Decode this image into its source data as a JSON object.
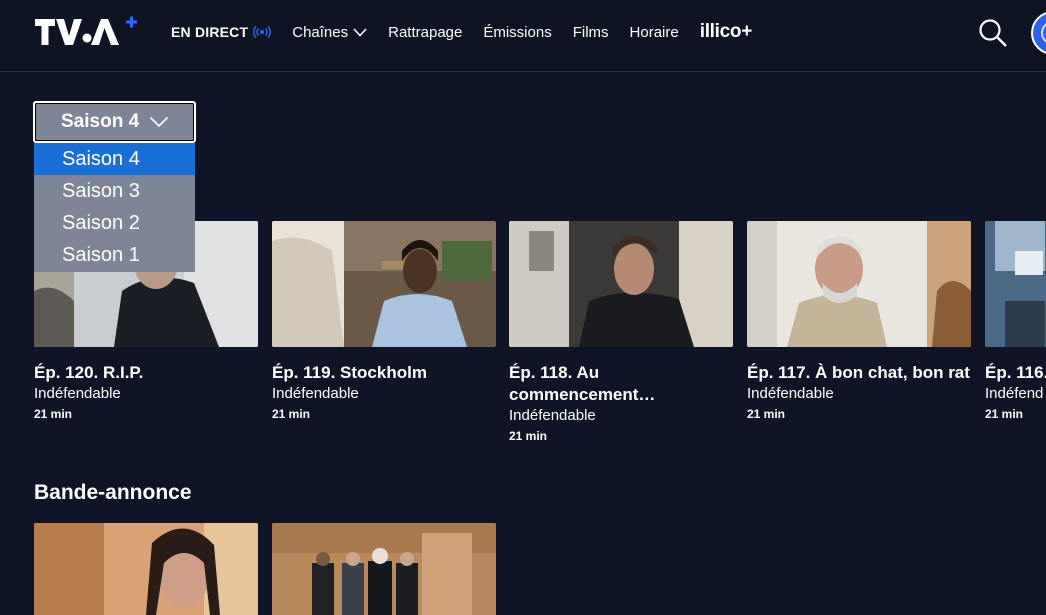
{
  "header": {
    "logo_alt": "TVA+",
    "nav": [
      {
        "label": "EN DIRECT",
        "id": "live"
      },
      {
        "label": "Chaînes",
        "id": "channels"
      },
      {
        "label": "Rattrapage",
        "id": "catchup"
      },
      {
        "label": "Émissions",
        "id": "shows"
      },
      {
        "label": "Films",
        "id": "films"
      },
      {
        "label": "Horaire",
        "id": "schedule"
      }
    ],
    "illico": "illico+"
  },
  "season_select": {
    "selected": "Saison 4",
    "options": [
      "Saison 4",
      "Saison 3",
      "Saison 2",
      "Saison 1"
    ]
  },
  "episodes": [
    {
      "title": "Ép. 120. R.I.P.",
      "show": "Indéfendable",
      "duration": "21 min"
    },
    {
      "title": "Ép. 119. Stockholm",
      "show": "Indéfendable",
      "duration": "21 min"
    },
    {
      "title": "Ép. 118. Au commencement…",
      "show": "Indéfendable",
      "duration": "21 min"
    },
    {
      "title": "Ép. 117. À bon chat, bon rat",
      "show": "Indéfendable",
      "duration": "21 min"
    },
    {
      "title": "Ép. 116.",
      "show": "Indéfend",
      "duration": "21 min"
    }
  ],
  "trailers_section": {
    "title": "Bande-annonce"
  },
  "colors": {
    "background": "#0f1526",
    "accent": "#2b62e8",
    "dropdown_bg": "#7d8596",
    "dropdown_selected": "#1a6fd6"
  }
}
